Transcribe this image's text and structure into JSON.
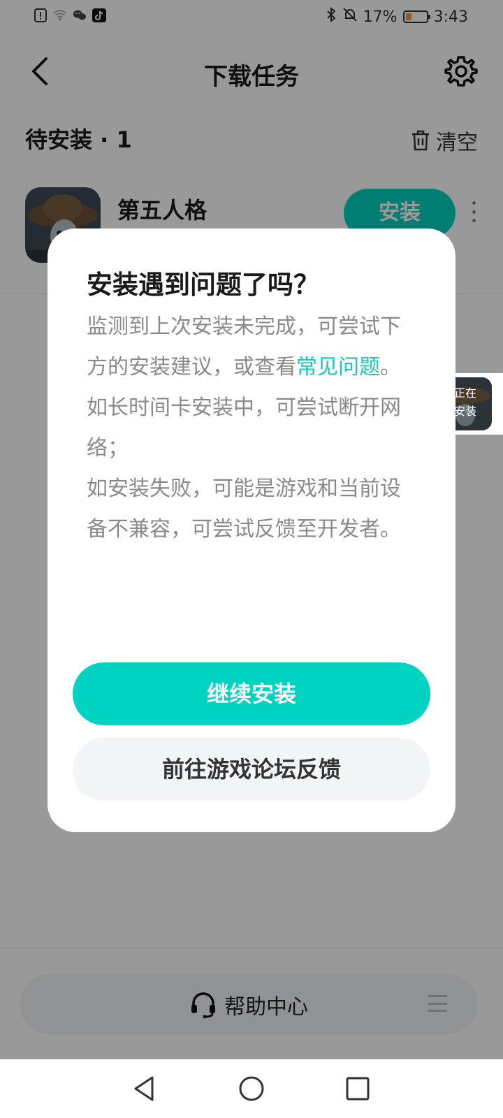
{
  "status_bar": {
    "battery_percent": "17%",
    "time": "3:43",
    "icons": [
      "alert-icon",
      "wifi-icon",
      "wechat-icon",
      "tiktok-icon",
      "bluetooth-icon",
      "mute-icon",
      "battery-icon"
    ],
    "battery_level": 0.17
  },
  "header": {
    "title": "下载任务"
  },
  "section": {
    "title": "待安装 · 1",
    "clear_label": "清空"
  },
  "task": {
    "name": "第五人格",
    "install_label": "安装"
  },
  "floating_widget": {
    "line1": "正在",
    "line2": "安装"
  },
  "dialog": {
    "title": "安装遇到问题了吗？",
    "body_part1": "监测到上次安装未完成，可尝试下方的安装建议，或查看",
    "link_text": "常见问题",
    "body_part2": "。",
    "line2": "如长时间卡安装中，可尝试断开网络；",
    "line3": "如安装失败，可能是游戏和当前设备不兼容，可尝试反馈至开发者。",
    "continue_label": "继续安装",
    "forum_label": "前往游戏论坛反馈"
  },
  "help": {
    "label": "帮助中心"
  },
  "colors": {
    "accent": "#00d2c2",
    "link": "#18c8b8",
    "overlay": "rgba(0,0,0,0.40)"
  }
}
